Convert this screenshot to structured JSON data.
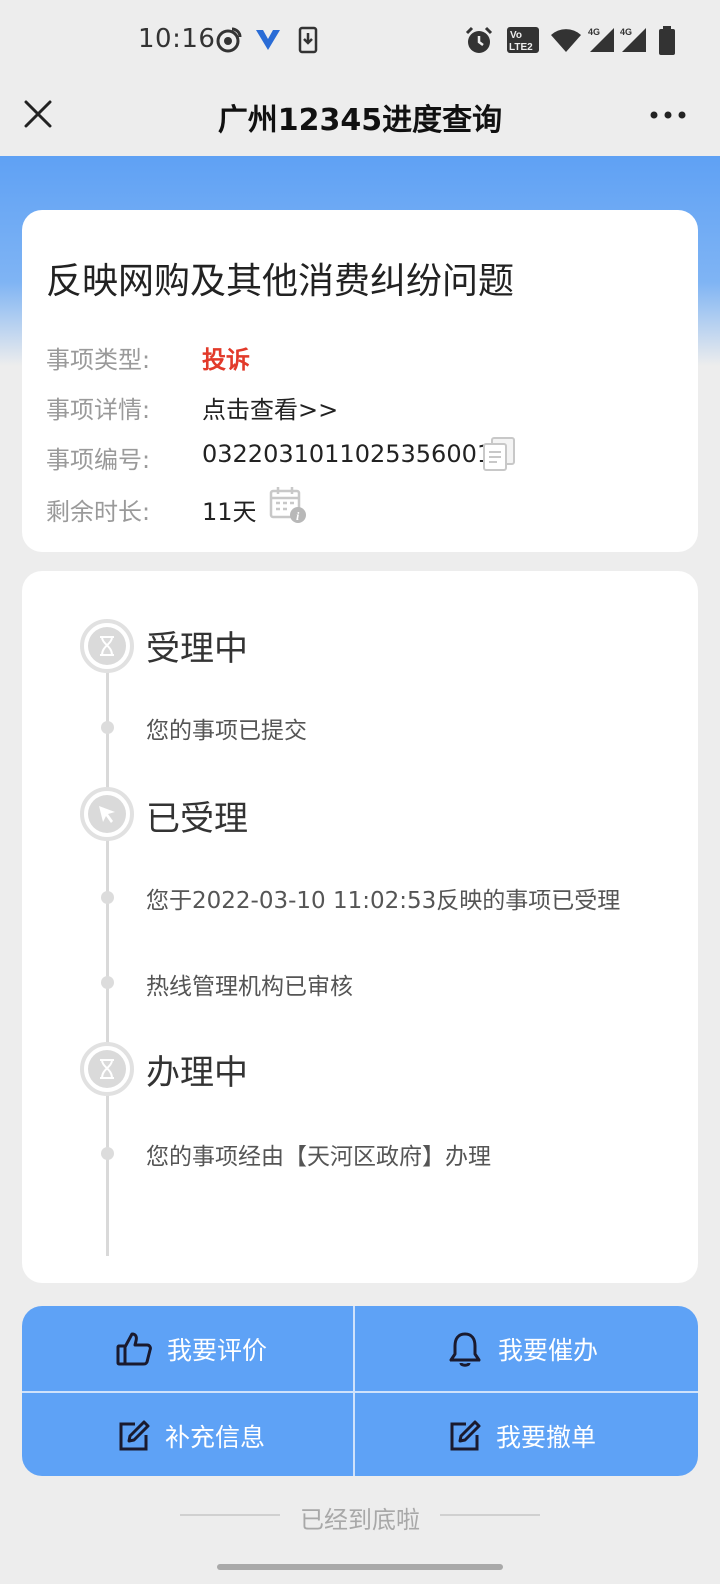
{
  "status_bar": {
    "time": "10:16",
    "icons": [
      "weibo-icon",
      "vpn-icon",
      "download-icon",
      "alarm-icon",
      "volte-icon",
      "wifi-icon",
      "signal-4g-icon",
      "signal-4g-icon",
      "battery-icon"
    ]
  },
  "header": {
    "title": "广州12345进度查询",
    "close_icon": "close-icon",
    "more_icon": "more-icon"
  },
  "info_card": {
    "title": "反映网购及其他消费纠纷问题",
    "rows": [
      {
        "label": "事项类型:",
        "value": "投诉"
      },
      {
        "label": "事项详情:",
        "value": "点击查看>>"
      },
      {
        "label": "事项编号:",
        "value": "0322031011025356001"
      },
      {
        "label": "剩余时长:",
        "value": "11天"
      }
    ]
  },
  "timeline": {
    "stages": [
      {
        "title": "受理中",
        "icon": "hourglass-icon",
        "steps": [
          "您的事项已提交"
        ]
      },
      {
        "title": "已受理",
        "icon": "cursor-icon",
        "steps": [
          "您于2022-03-10 11:02:53反映的事项已受理",
          "热线管理机构已审核"
        ]
      },
      {
        "title": "办理中",
        "icon": "hourglass-icon",
        "steps": [
          "您的事项经由【天河区政府】办理"
        ]
      }
    ]
  },
  "actions": {
    "evaluate": "我要评价",
    "urge": "我要催办",
    "supplement": "补充信息",
    "withdraw": "我要撤单"
  },
  "footer": {
    "end_text": "已经到底啦"
  },
  "colors": {
    "accent_blue": "#5ea2f6",
    "complaint_red": "#e23a2a"
  }
}
